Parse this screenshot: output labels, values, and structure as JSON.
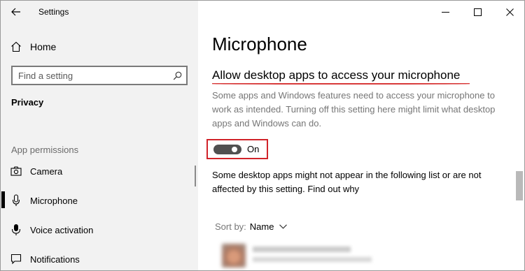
{
  "app": {
    "title": "Settings"
  },
  "nav": {
    "home_label": "Home",
    "search_placeholder": "Find a setting",
    "section_privacy": "Privacy",
    "section_app_permissions": "App permissions",
    "items": [
      {
        "label": "Camera",
        "icon": "camera-icon",
        "active": false
      },
      {
        "label": "Microphone",
        "icon": "microphone-icon",
        "active": true
      },
      {
        "label": "Voice activation",
        "icon": "voice-activation-icon",
        "active": false
      },
      {
        "label": "Notifications",
        "icon": "notifications-icon",
        "active": false
      }
    ]
  },
  "main": {
    "title": "Microphone",
    "setting_heading": "Allow desktop apps to access your microphone",
    "description": "Some apps and Windows features need to access your microphone to work as intended. Turning off this setting here might limit what desktop apps and Windows can do.",
    "toggle": {
      "state_label": "On",
      "on": true
    },
    "note_text": "Some desktop apps might not appear in the following list or are not affected by this setting.",
    "note_link": "Find out why",
    "sort_label": "Sort by:",
    "sort_value": "Name"
  },
  "colors": {
    "accent_highlight": "#d1232a",
    "left_pane_bg": "#f2f2f2",
    "toggle_on": "#505050"
  }
}
